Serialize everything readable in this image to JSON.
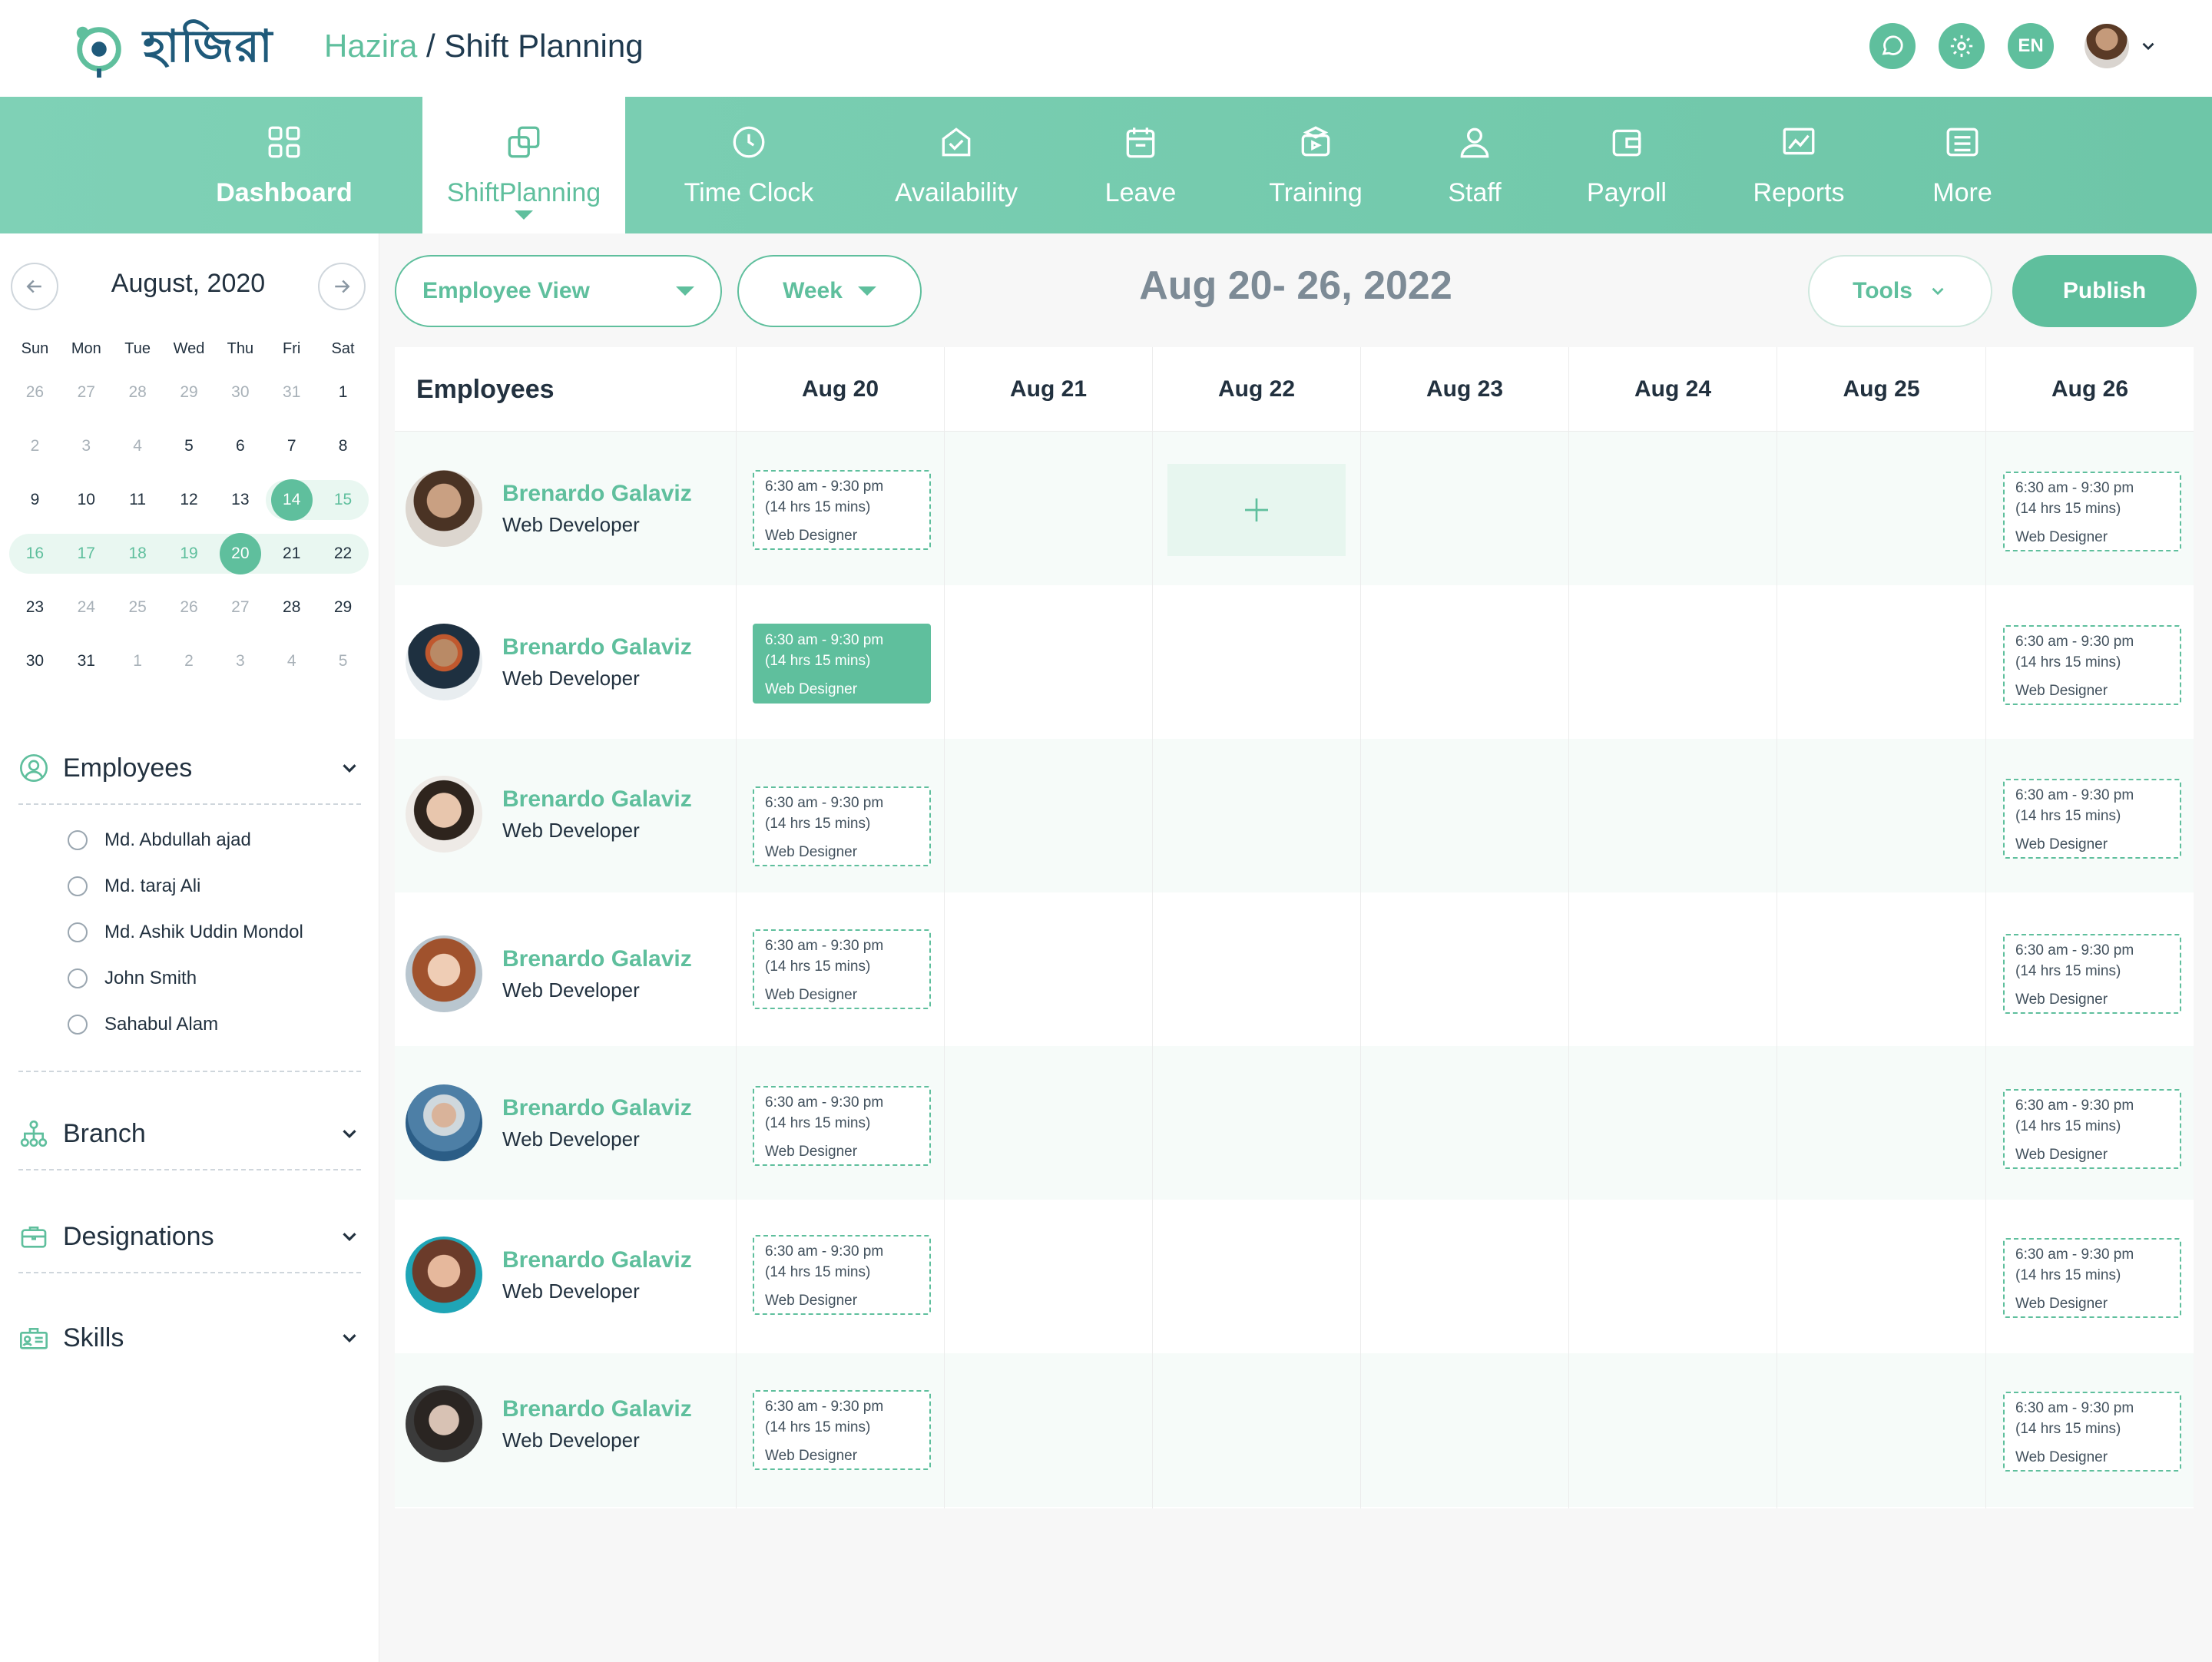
{
  "header": {
    "logo_text": "হাজিরা",
    "breadcrumb_root": "Hazira",
    "breadcrumb_sep": " / ",
    "breadcrumb_page": "Shift Planning",
    "lang": "EN"
  },
  "nav": [
    {
      "label": "Dashboard",
      "icon": "dashboard-icon"
    },
    {
      "label": "ShiftPlanning",
      "icon": "shift-planning-icon",
      "active": true
    },
    {
      "label": "Time Clock",
      "icon": "clock-icon"
    },
    {
      "label": "Availability",
      "icon": "availability-icon"
    },
    {
      "label": "Leave",
      "icon": "calendar-icon"
    },
    {
      "label": "Training",
      "icon": "training-icon"
    },
    {
      "label": "Staff",
      "icon": "staff-icon"
    },
    {
      "label": "Payroll",
      "icon": "wallet-icon"
    },
    {
      "label": "Reports",
      "icon": "chart-icon"
    },
    {
      "label": "More",
      "icon": "list-icon"
    }
  ],
  "calendar": {
    "title": "August, 2020",
    "dow": [
      "Sun",
      "Mon",
      "Tue",
      "Wed",
      "Thu",
      "Fri",
      "Sat"
    ],
    "weeks": [
      [
        "26",
        "27",
        "28",
        "29",
        "30",
        "31",
        "1"
      ],
      [
        "2",
        "3",
        "4",
        "5",
        "6",
        "7",
        "8"
      ],
      [
        "9",
        "10",
        "11",
        "12",
        "13",
        "14",
        "15"
      ],
      [
        "16",
        "17",
        "18",
        "19",
        "20",
        "21",
        "22"
      ],
      [
        "23",
        "24",
        "25",
        "26",
        "27",
        "28",
        "29"
      ],
      [
        "30",
        "31",
        "1",
        "2",
        "3",
        "4",
        "5"
      ]
    ]
  },
  "filters": {
    "employees_label": "Employees",
    "employees": [
      "Md. Abdullah ajad",
      "Md. taraj Ali",
      "Md. Ashik Uddin Mondol",
      "John Smith",
      "Sahabul Alam"
    ],
    "branch_label": "Branch",
    "designations_label": "Designations",
    "skills_label": "Skills"
  },
  "toolbar": {
    "view": "Employee View",
    "period": "Week",
    "range": "Aug 20- 26, 2022",
    "tools": "Tools",
    "publish": "Publish"
  },
  "schedule": {
    "employees_header": "Employees",
    "days": [
      "Aug 20",
      "Aug 21",
      "Aug 22",
      "Aug 23",
      "Aug 24",
      "Aug 25",
      "Aug 26"
    ],
    "shift": {
      "time": "6:30 am - 9:30 pm",
      "duration": "(14 hrs 15 mins)",
      "role": "Web Designer"
    },
    "rows": [
      {
        "name": "Brenardo Galaviz",
        "role": "Web Developer"
      },
      {
        "name": "Brenardo Galaviz",
        "role": "Web Developer"
      },
      {
        "name": "Brenardo Galaviz",
        "role": "Web Developer"
      },
      {
        "name": "Brenardo Galaviz",
        "role": "Web Developer"
      },
      {
        "name": "Brenardo Galaviz",
        "role": "Web Developer"
      },
      {
        "name": "Brenardo Galaviz",
        "role": "Web Developer"
      },
      {
        "name": "Brenardo Galaviz",
        "role": "Web Developer"
      }
    ]
  },
  "colors": {
    "accent": "#5fbf9d",
    "text": "#22313f",
    "muted": "#7d8b96"
  }
}
